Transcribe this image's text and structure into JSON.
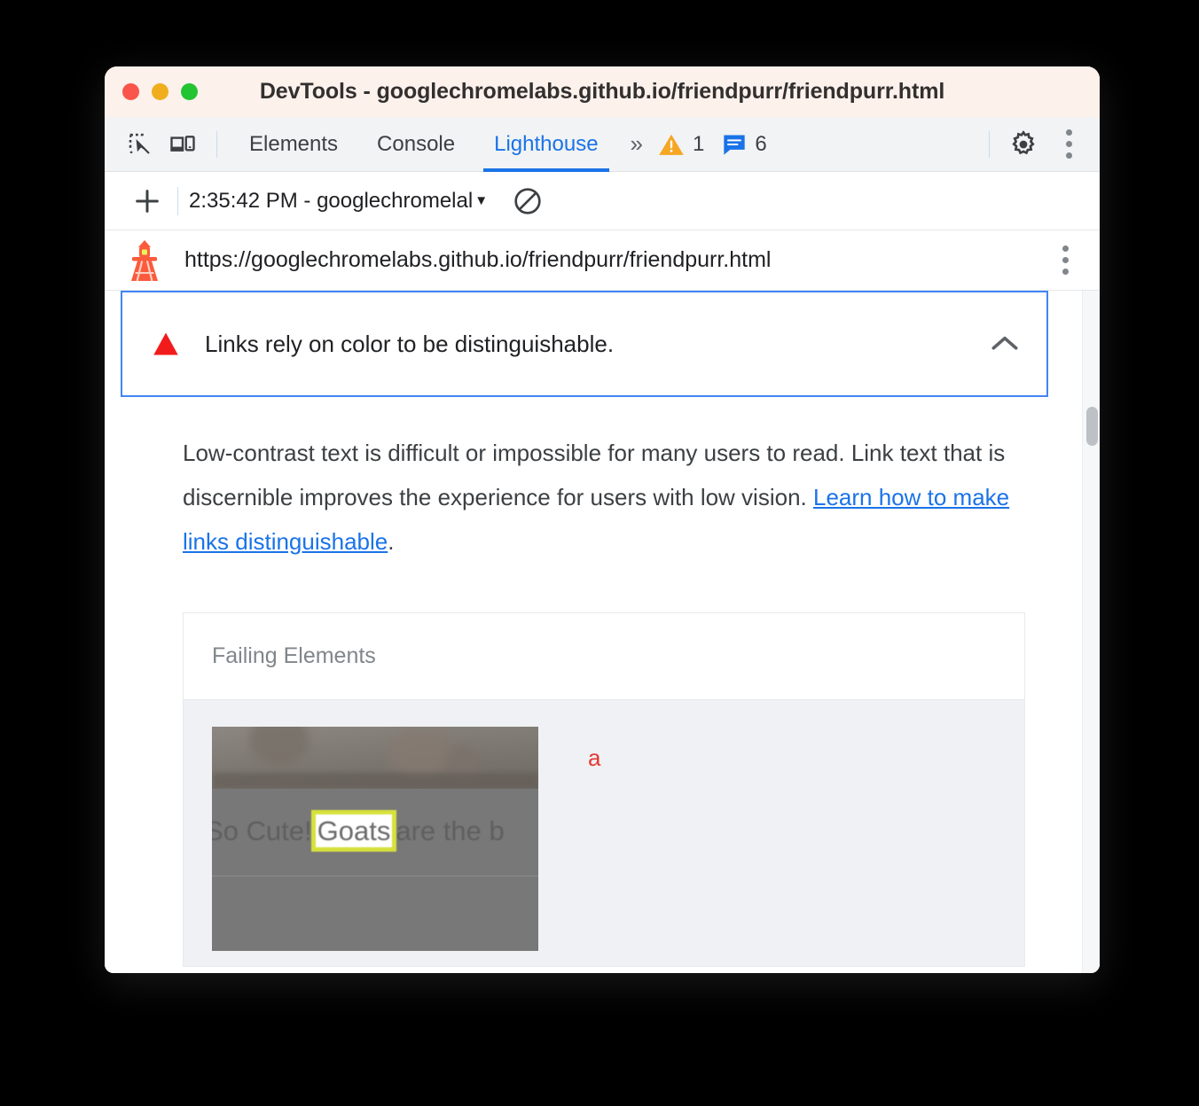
{
  "window": {
    "title": "DevTools - googlechromelabs.github.io/friendpurr/friendpurr.html",
    "traffic_lights": [
      {
        "name": "close",
        "color": "#f9554a"
      },
      {
        "name": "minimize",
        "color": "#f0ae1e"
      },
      {
        "name": "maximize",
        "color": "#23c431"
      }
    ]
  },
  "devtools_tabbar": {
    "inspect_icon": "inspect-element-icon",
    "device_toolbar_icon": "device-toolbar-icon",
    "tabs": [
      {
        "label": "Elements",
        "active": false
      },
      {
        "label": "Console",
        "active": false
      },
      {
        "label": "Lighthouse",
        "active": true
      }
    ],
    "more_tabs_label": "»",
    "warnings_count": "1",
    "messages_count": "6",
    "settings_icon": "gear-icon",
    "main_menu_icon": "kebab-menu-icon",
    "accent_color": "#1a73e8",
    "warning_color": "#f5a623",
    "message_color": "#1a73e8"
  },
  "runbar": {
    "new_report_icon": "plus-icon",
    "selected_run": "2:35:42 PM - googlechromelal",
    "dropdown_caret": "▼",
    "clear_icon": "clear-all-icon"
  },
  "urlbar": {
    "logo_icon": "lighthouse-icon",
    "url": "https://googlechromelabs.github.io/friendpurr/friendpurr.html",
    "menu_icon": "kebab-menu-icon"
  },
  "audit": {
    "status_icon": "red-triangle-fail-icon",
    "title": "Links rely on color to be distinguishable.",
    "collapse_icon": "chevron-up-icon",
    "description_part1": "Low-contrast text is difficult or impossible for many users to read. Link text that is discernible improves the experience for users with low vision. ",
    "description_link": "Learn how to make links distinguishable",
    "description_part2": ".",
    "border_color": "#4285f4",
    "link_color": "#1a73e8"
  },
  "failing_table": {
    "column_header": "Failing Elements",
    "rows": [
      {
        "thumbnail_name": "failing-element-thumbnail",
        "thumbnail_headline_before": "So Cute!",
        "thumbnail_headline_highlight": "Goats",
        "thumbnail_headline_after": "are the b",
        "highlight_color": "#d6e23c",
        "snippet": "a",
        "snippet_color": "#e53935"
      }
    ]
  },
  "scrollbar": {
    "name": "report-vertical-scrollbar",
    "thumb_color": "#bdc1c6"
  }
}
